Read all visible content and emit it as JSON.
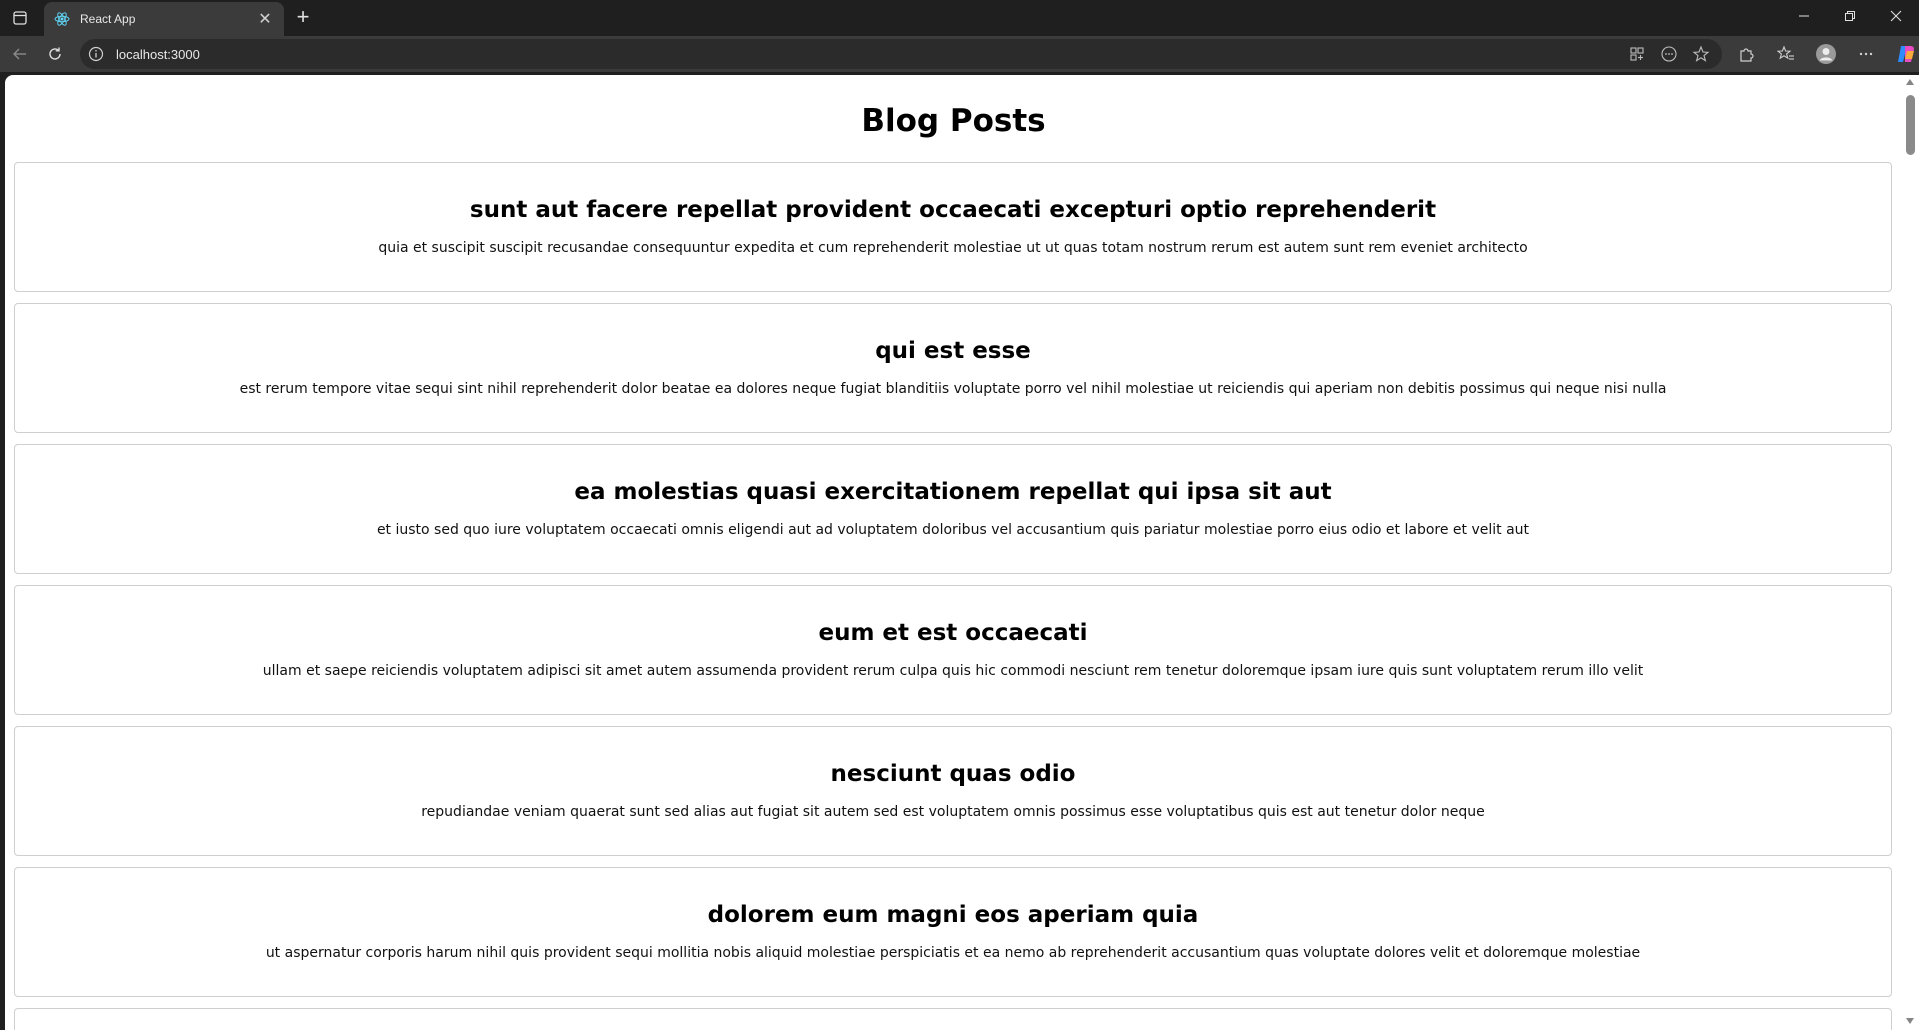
{
  "browser": {
    "tab": {
      "title": "React App"
    },
    "address_bar": {
      "url": "localhost:3000"
    }
  },
  "page": {
    "heading": "Blog Posts",
    "posts": [
      {
        "title": "sunt aut facere repellat provident occaecati excepturi optio reprehenderit",
        "body": "quia et suscipit suscipit recusandae consequuntur expedita et cum reprehenderit molestiae ut ut quas totam nostrum rerum est autem sunt rem eveniet architecto"
      },
      {
        "title": "qui est esse",
        "body": "est rerum tempore vitae sequi sint nihil reprehenderit dolor beatae ea dolores neque fugiat blanditiis voluptate porro vel nihil molestiae ut reiciendis qui aperiam non debitis possimus qui neque nisi nulla"
      },
      {
        "title": "ea molestias quasi exercitationem repellat qui ipsa sit aut",
        "body": "et iusto sed quo iure voluptatem occaecati omnis eligendi aut ad voluptatem doloribus vel accusantium quis pariatur molestiae porro eius odio et labore et velit aut"
      },
      {
        "title": "eum et est occaecati",
        "body": "ullam et saepe reiciendis voluptatem adipisci sit amet autem assumenda provident rerum culpa quis hic commodi nesciunt rem tenetur doloremque ipsam iure quis sunt voluptatem rerum illo velit"
      },
      {
        "title": "nesciunt quas odio",
        "body": "repudiandae veniam quaerat sunt sed alias aut fugiat sit autem sed est voluptatem omnis possimus esse voluptatibus quis est aut tenetur dolor neque"
      },
      {
        "title": "dolorem eum magni eos aperiam quia",
        "body": "ut aspernatur corporis harum nihil quis provident sequi mollitia nobis aliquid molestiae perspiciatis et ea nemo ab reprehenderit accusantium quas voluptate dolores velit et doloremque molestiae"
      }
    ]
  }
}
